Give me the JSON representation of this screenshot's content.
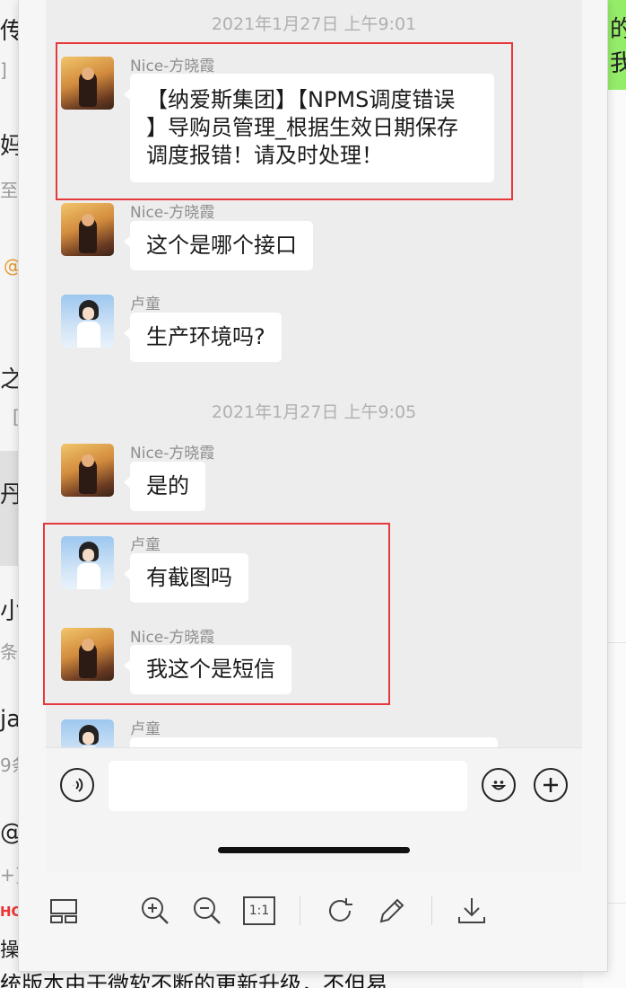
{
  "background": {
    "left_fragments": [
      "传",
      "]",
      "妈",
      "至",
      "@",
      "之",
      "[",
      "丹",
      "",
      "小",
      "条",
      "ja",
      "9条",
      "@",
      "+]",
      "HO",
      "操"
    ],
    "right_fragments": [
      "的",
      "我"
    ],
    "bottom_text": "统版本由于微软不断的更新升级，不但易"
  },
  "chat": {
    "timestamps": [
      "2021年1月27日 上午9:01",
      "2021年1月27日 上午9:05"
    ],
    "messages": [
      {
        "sender": "Nice-方晓霞",
        "text_lines": [
          "【纳爱斯集团】【NPMS调度错误",
          "】导购员管理_根据生效日期保存",
          "调度报错！请及时处理！"
        ]
      },
      {
        "sender": "Nice-方晓霞",
        "text": "这个是哪个接口"
      },
      {
        "sender": "卢童",
        "text": "生产环境吗?"
      },
      {
        "sender": "Nice-方晓霞",
        "text": "是的"
      },
      {
        "sender": "卢童",
        "text": "有截图吗"
      },
      {
        "sender": "Nice-方晓霞",
        "text": "我这个是短信"
      },
      {
        "sender": "卢童",
        "text": ""
      }
    ]
  },
  "input": {
    "placeholder": ""
  },
  "icons": {
    "voice": "voice-icon",
    "emoji": "emoji-icon",
    "plus": "plus-icon",
    "toolbar": [
      "thumbnails-icon",
      "zoom-in-icon",
      "zoom-out-icon",
      "actual-size-icon",
      "rotate-icon",
      "edit-icon",
      "download-icon"
    ]
  },
  "toolbar": {
    "actual_size_label": "1:1"
  },
  "colors": {
    "highlight_box": "#e5393b",
    "chat_bg": "#ededed",
    "bubble": "#ffffff",
    "green": "#95ec69"
  }
}
